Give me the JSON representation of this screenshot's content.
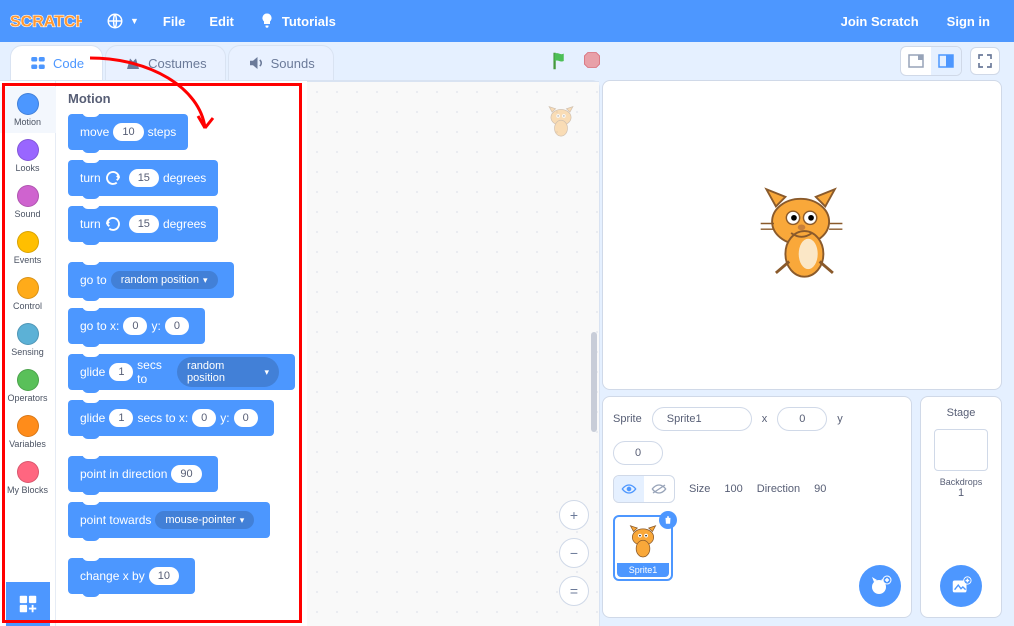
{
  "topbar": {
    "logo_text": "SCRATCH",
    "file": "File",
    "edit": "Edit",
    "tutorials": "Tutorials",
    "join": "Join Scratch",
    "signin": "Sign in"
  },
  "tabs": {
    "code": "Code",
    "costumes": "Costumes",
    "sounds": "Sounds"
  },
  "categories": [
    {
      "name": "Motion",
      "color": "#4c97ff"
    },
    {
      "name": "Looks",
      "color": "#9966ff"
    },
    {
      "name": "Sound",
      "color": "#cf63cf"
    },
    {
      "name": "Events",
      "color": "#ffbf00"
    },
    {
      "name": "Control",
      "color": "#ffab19"
    },
    {
      "name": "Sensing",
      "color": "#5cb1d6"
    },
    {
      "name": "Operators",
      "color": "#59c059"
    },
    {
      "name": "Variables",
      "color": "#ff8c1a"
    },
    {
      "name": "My Blocks",
      "color": "#ff6680"
    }
  ],
  "palette": {
    "heading": "Motion",
    "blocks": {
      "move_a": "move",
      "move_v": "10",
      "move_b": "steps",
      "turn_cw_a": "turn",
      "turn_cw_v": "15",
      "turn_cw_b": "degrees",
      "turn_ccw_a": "turn",
      "turn_ccw_v": "15",
      "turn_ccw_b": "degrees",
      "goto_a": "go to",
      "goto_dd": "random position",
      "gotoxy_a": "go to x:",
      "gotoxy_x": "0",
      "gotoxy_b": "y:",
      "gotoxy_y": "0",
      "glide1_a": "glide",
      "glide1_s": "1",
      "glide1_b": "secs to",
      "glide1_dd": "random position",
      "glide2_a": "glide",
      "glide2_s": "1",
      "glide2_b": "secs to x:",
      "glide2_x": "0",
      "glide2_c": "y:",
      "glide2_y": "0",
      "point_dir_a": "point in direction",
      "point_dir_v": "90",
      "point_tw_a": "point towards",
      "point_tw_dd": "mouse-pointer",
      "changex_a": "change x by",
      "changex_v": "10"
    }
  },
  "sprite_info": {
    "label_sprite": "Sprite",
    "name": "Sprite1",
    "label_x": "x",
    "x": "0",
    "label_y": "y",
    "y": "0",
    "label_size": "Size",
    "size": "100",
    "label_direction": "Direction",
    "direction": "90"
  },
  "sprite_thumb": {
    "label": "Sprite1"
  },
  "stage_panel": {
    "title": "Stage",
    "backdrops_label": "Backdrops",
    "backdrops_count": "1"
  },
  "zoom": {
    "in": "+",
    "out": "−",
    "reset": "="
  }
}
